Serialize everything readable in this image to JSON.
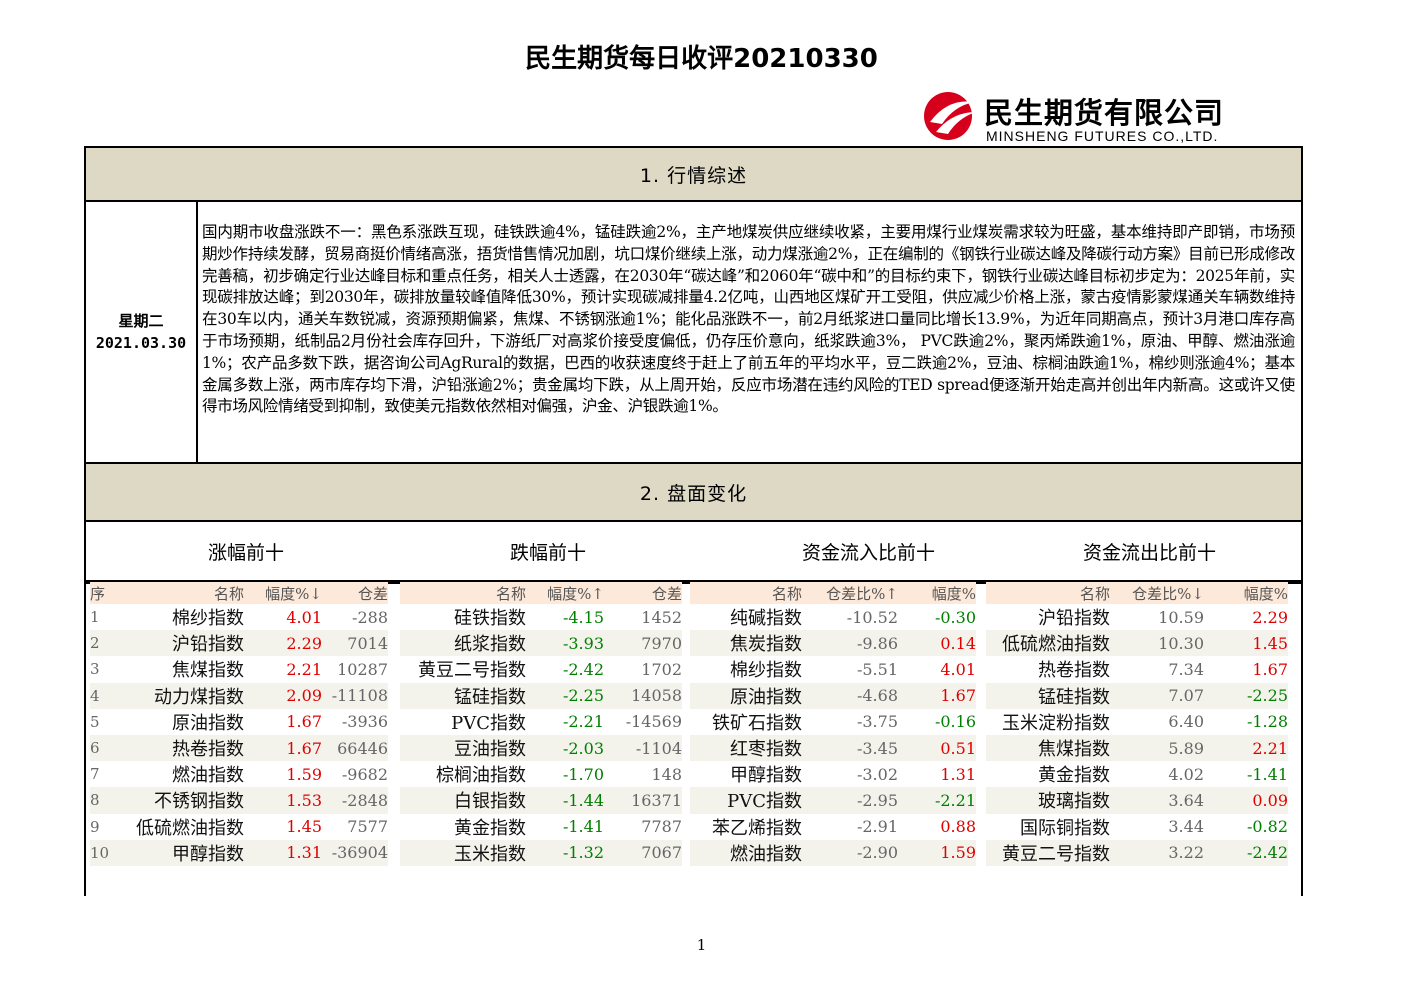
{
  "title": "民生期货每日收评20210330",
  "logo": {
    "cn": "民生期货有限公司",
    "en": "MINSHENG FUTURES CO.,LTD."
  },
  "section1": {
    "heading": "1. 行情综述"
  },
  "summary": {
    "weekday": "星期二",
    "date": "2021.03.30",
    "text": "国内期市收盘涨跌不一：黑色系涨跌互现，硅铁跌逾4%，锰硅跌逾2%，主产地煤炭供应继续收紧，主要用煤行业煤炭需求较为旺盛，基本维持即产即销，市场预期炒作持续发酵，贸易商挺价情绪高涨，捂货惜售情况加剧，坑口煤价继续上涨，动力煤涨逾2%，正在编制的《钢铁行业碳达峰及降碳行动方案》目前已形成修改完善稿，初步确定行业达峰目标和重点任务，相关人士透露，在2030年“碳达峰”和2060年“碳中和”的目标约束下，钢铁行业碳达峰目标初步定为：2025年前，实现碳排放达峰；到2030年，碳排放量较峰值降低30%，预计实现碳减排量4.2亿吨，山西地区煤矿开工受阻，供应减少价格上涨，蒙古疫情影蒙煤通关车辆数维持在30车以内，通关车数锐减，资源预期偏紧，焦煤、不锈钢涨逾1%；能化品涨跌不一，前2月纸浆进口量同比增长13.9%，为近年同期高点，预计3月港口库存高于市场预期，纸制品2月份社会库存回升，下游纸厂对高浆价接受度偏低，仍存压价意向，纸浆跌逾3%， PVC跌逾2%，聚丙烯跌逾1%，原油、甲醇、燃油涨逾1%；农产品多数下跌，据咨询公司AgRural的数据，巴西的收获速度终于赶上了前五年的平均水平，豆二跌逾2%，豆油、棕榈油跌逾1%，棉纱则涨逾4%；基本金属多数上涨，两市库存均下滑，沪铅涨逾2%；贵金属均下跌，从上周开始，反应市场潜在违约风险的TED spread便逐渐开始走高并创出年内新高。这或许又使得市场风险情绪受到抑制，致使美元指数依然相对偏强，沪金、沪银跌逾1%。"
  },
  "section2": {
    "heading": "2. 盘面变化",
    "cols": [
      "涨幅前十",
      "跌幅前十",
      "资金流入比前十",
      "资金流出比前十"
    ]
  },
  "headers": {
    "seq": "序",
    "name": "名称",
    "pct_down": "幅度%↓",
    "pct_up": "幅度%↑",
    "oi": "仓差",
    "oi_ratio_up": "仓差比%↑",
    "oi_ratio_down": "仓差比%↓",
    "pct": "幅度%"
  },
  "tables": {
    "gainers": [
      {
        "seq": "1",
        "name": "棉纱指数",
        "pct": "4.01",
        "oi": "-288"
      },
      {
        "seq": "2",
        "name": "沪铅指数",
        "pct": "2.29",
        "oi": "7014"
      },
      {
        "seq": "3",
        "name": "焦煤指数",
        "pct": "2.21",
        "oi": "10287"
      },
      {
        "seq": "4",
        "name": "动力煤指数",
        "pct": "2.09",
        "oi": "-11108"
      },
      {
        "seq": "5",
        "name": "原油指数",
        "pct": "1.67",
        "oi": "-3936"
      },
      {
        "seq": "6",
        "name": "热卷指数",
        "pct": "1.67",
        "oi": "66446"
      },
      {
        "seq": "7",
        "name": "燃油指数",
        "pct": "1.59",
        "oi": "-9682"
      },
      {
        "seq": "8",
        "name": "不锈钢指数",
        "pct": "1.53",
        "oi": "-2848"
      },
      {
        "seq": "9",
        "name": "低硫燃油指数",
        "pct": "1.45",
        "oi": "7577"
      },
      {
        "seq": "10",
        "name": "甲醇指数",
        "pct": "1.31",
        "oi": "-36904"
      }
    ],
    "losers": [
      {
        "name": "硅铁指数",
        "pct": "-4.15",
        "oi": "1452"
      },
      {
        "name": "纸浆指数",
        "pct": "-3.93",
        "oi": "7970"
      },
      {
        "name": "黄豆二号指数",
        "pct": "-2.42",
        "oi": "1702"
      },
      {
        "name": "锰硅指数",
        "pct": "-2.25",
        "oi": "14058"
      },
      {
        "name": "PVC指数",
        "pct": "-2.21",
        "oi": "-14569"
      },
      {
        "name": "豆油指数",
        "pct": "-2.03",
        "oi": "-1104"
      },
      {
        "name": "棕榈油指数",
        "pct": "-1.70",
        "oi": "148"
      },
      {
        "name": "白银指数",
        "pct": "-1.44",
        "oi": "16371"
      },
      {
        "name": "黄金指数",
        "pct": "-1.41",
        "oi": "7787"
      },
      {
        "name": "玉米指数",
        "pct": "-1.32",
        "oi": "7067"
      }
    ],
    "inflow": [
      {
        "name": "纯碱指数",
        "ratio": "-10.52",
        "pct": "-0.30"
      },
      {
        "name": "焦炭指数",
        "ratio": "-9.86",
        "pct": "0.14"
      },
      {
        "name": "棉纱指数",
        "ratio": "-5.51",
        "pct": "4.01"
      },
      {
        "name": "原油指数",
        "ratio": "-4.68",
        "pct": "1.67"
      },
      {
        "name": "铁矿石指数",
        "ratio": "-3.75",
        "pct": "-0.16"
      },
      {
        "name": "红枣指数",
        "ratio": "-3.45",
        "pct": "0.51"
      },
      {
        "name": "甲醇指数",
        "ratio": "-3.02",
        "pct": "1.31"
      },
      {
        "name": "PVC指数",
        "ratio": "-2.95",
        "pct": "-2.21"
      },
      {
        "name": "苯乙烯指数",
        "ratio": "-2.91",
        "pct": "0.88"
      },
      {
        "name": "燃油指数",
        "ratio": "-2.90",
        "pct": "1.59"
      }
    ],
    "outflow": [
      {
        "name": "沪铅指数",
        "ratio": "10.59",
        "pct": "2.29"
      },
      {
        "name": "低硫燃油指数",
        "ratio": "10.30",
        "pct": "1.45"
      },
      {
        "name": "热卷指数",
        "ratio": "7.34",
        "pct": "1.67"
      },
      {
        "name": "锰硅指数",
        "ratio": "7.07",
        "pct": "-2.25"
      },
      {
        "name": "玉米淀粉指数",
        "ratio": "6.40",
        "pct": "-1.28"
      },
      {
        "name": "焦煤指数",
        "ratio": "5.89",
        "pct": "2.21"
      },
      {
        "name": "黄金指数",
        "ratio": "4.02",
        "pct": "-1.41"
      },
      {
        "name": "玻璃指数",
        "ratio": "3.64",
        "pct": "0.09"
      },
      {
        "name": "国际铜指数",
        "ratio": "3.44",
        "pct": "-0.82"
      },
      {
        "name": "黄豆二号指数",
        "ratio": "3.22",
        "pct": "-2.42"
      }
    ]
  },
  "colors": {
    "up": "#e00000",
    "down": "#008000",
    "section_bg": "#ddd9c4",
    "header_bg": "#fde9d9"
  },
  "page_number": "1"
}
